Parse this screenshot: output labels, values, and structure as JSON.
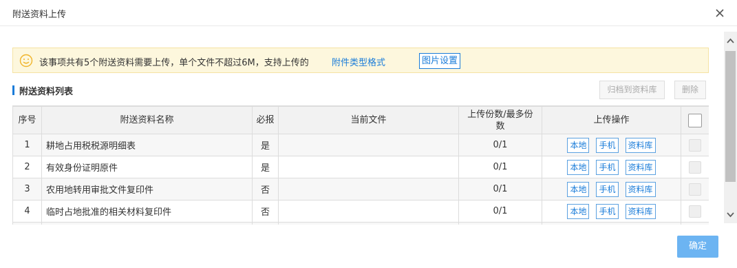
{
  "dialog": {
    "title": "附送资料上传"
  },
  "notice": {
    "text": "该事项共有5个附送资料需要上传，单个文件不超过6M，支持上传的",
    "link": "附件类型格式",
    "photo_settings": "图片设置"
  },
  "section": {
    "title": "附送资料列表",
    "archive_btn": "归档到资料库",
    "delete_btn": "删除"
  },
  "table": {
    "headers": {
      "index": "序号",
      "name": "附送资料名称",
      "required": "必报",
      "current_file": "当前文件",
      "count_line1": "上传份数/最多份",
      "count_line2": "数",
      "ops": "上传操作"
    },
    "op_labels": {
      "local": "本地",
      "phone": "手机",
      "library": "资料库"
    },
    "rows": [
      {
        "index": "1",
        "name": "耕地占用税税源明细表",
        "required": "是",
        "file": "",
        "count": "0/1"
      },
      {
        "index": "2",
        "name": "有效身份证明原件",
        "required": "是",
        "file": "",
        "count": "0/1"
      },
      {
        "index": "3",
        "name": "农用地转用审批文件复印件",
        "required": "否",
        "file": "",
        "count": "0/1"
      },
      {
        "index": "4",
        "name": "临时占地批准的相关材料复印件",
        "required": "否",
        "file": "",
        "count": "0/1"
      },
      {
        "index": "",
        "name": "",
        "required": "",
        "file": "",
        "count": ""
      }
    ]
  },
  "footer": {
    "confirm": "确定"
  }
}
